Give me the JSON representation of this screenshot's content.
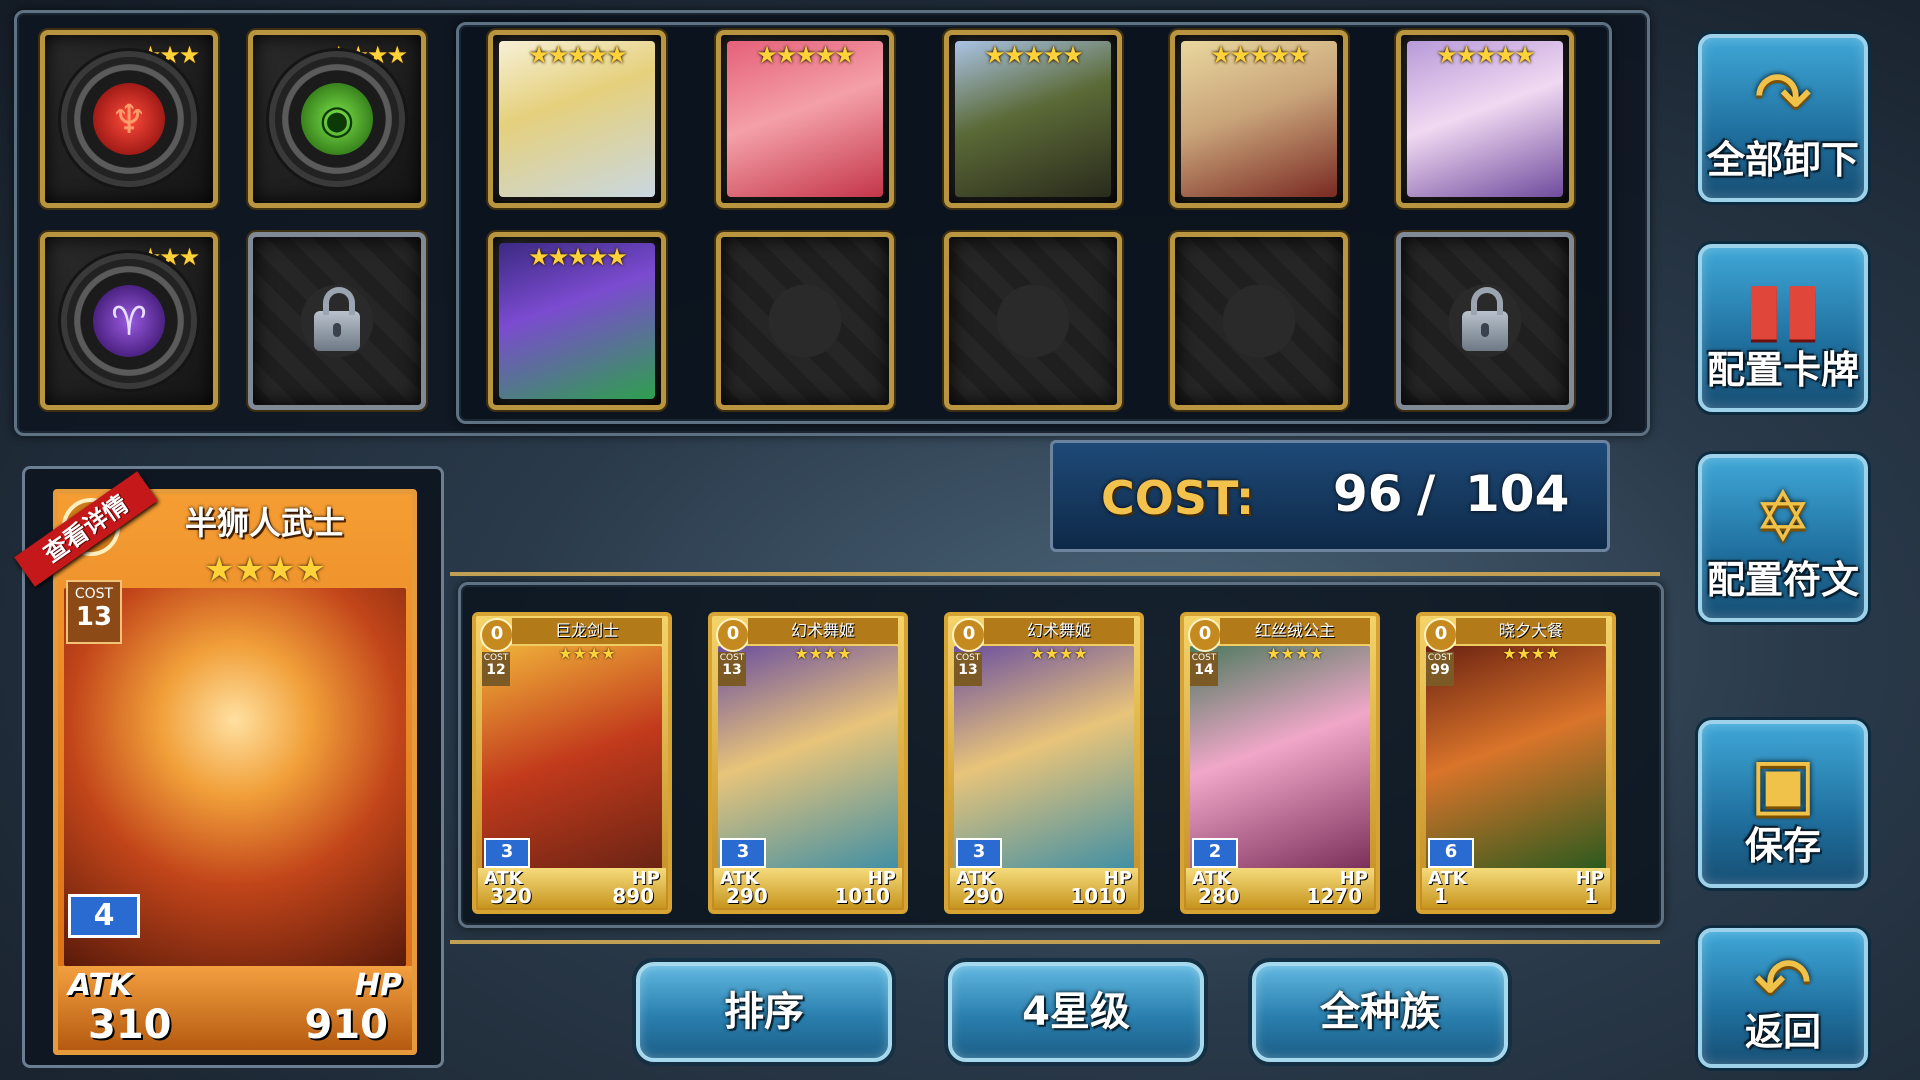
{
  "runes": [
    {
      "stars": "★★★",
      "symbol": "♆",
      "gem_color": "#c0161a",
      "sym_color": "#ff5a3a",
      "icon": "fire-rune-icon"
    },
    {
      "stars": "★★★★",
      "symbol": "◉",
      "gem_color": "#3aa01a",
      "sym_color": "#0c3a06",
      "icon": "eye-rune-icon"
    },
    {
      "stars": "★★★",
      "symbol": "♈",
      "gem_color": "#5a1a9c",
      "sym_color": "#e6ddff",
      "icon": "dark-rune-icon"
    }
  ],
  "deck_slots": [
    {
      "stars": "★★★★★",
      "art": "linear-gradient(160deg,#f7f0d6,#e5d07c 40%,#c9d7e0)"
    },
    {
      "stars": "★★★★★",
      "art": "linear-gradient(160deg,#e5607a,#f4a0a8 45%,#c4364a)"
    },
    {
      "stars": "★★★★★",
      "art": "linear-gradient(160deg,#aac3e6,#5b6a37 45%,#2a2b1c)"
    },
    {
      "stars": "★★★★★",
      "art": "linear-gradient(160deg,#e9d79e,#c9a47a 45%,#7a2a22)"
    },
    {
      "stars": "★★★★★",
      "art": "linear-gradient(160deg,#b79ad8,#f1d9f2 45%,#6f4c9e)"
    },
    {
      "stars": "★★★★★",
      "art": "linear-gradient(160deg,#3b2a82,#7b4bd0 40%,#2ea04d)"
    }
  ],
  "cost": {
    "label": "COST:",
    "current": "96",
    "slash": "/",
    "max": "104"
  },
  "featured": {
    "ribbon": "查看详情",
    "badge_value": "0",
    "name": "半狮人武士",
    "stars": "★★★★",
    "cost_label": "COST",
    "cost_value": "13",
    "level": "4",
    "atk_label": "ATK",
    "hp_label": "HP",
    "atk": "310",
    "hp": "910"
  },
  "cards": [
    {
      "badge": "0",
      "name": "巨龙剑士",
      "cost_label": "COST",
      "cost": "12",
      "stars": "★★★★",
      "level": "3",
      "atk_label": "ATK",
      "hp_label": "HP",
      "atk": "320",
      "hp": "890",
      "art": "linear-gradient(160deg,#f1b43a,#c23a1c 50%,#6a2414)"
    },
    {
      "badge": "0",
      "name": "幻术舞姬",
      "cost_label": "COST",
      "cost": "13",
      "stars": "★★★★",
      "level": "3",
      "atk_label": "ATK",
      "hp_label": "HP",
      "atk": "290",
      "hp": "1010",
      "art": "linear-gradient(160deg,#6a4fa0,#e8c47a 45%,#3f8fa5)"
    },
    {
      "badge": "0",
      "name": "幻术舞姬",
      "cost_label": "COST",
      "cost": "13",
      "stars": "★★★★",
      "level": "3",
      "atk_label": "ATK",
      "hp_label": "HP",
      "atk": "290",
      "hp": "1010",
      "art": "linear-gradient(160deg,#6a4fa0,#e8c47a 45%,#3f8fa5)"
    },
    {
      "badge": "0",
      "name": "红丝绒公主",
      "cost_label": "COST",
      "cost": "14",
      "stars": "★★★★",
      "level": "2",
      "atk_label": "ATK",
      "hp_label": "HP",
      "atk": "280",
      "hp": "1270",
      "art": "linear-gradient(160deg,#4c7a5e,#f0a7c8 45%,#7a2f5a)"
    },
    {
      "badge": "0",
      "name": "晓夕大餐",
      "cost_label": "COST",
      "cost": "99",
      "stars": "★★★★",
      "level": "6",
      "atk_label": "ATK",
      "hp_label": "HP",
      "atk": "1",
      "hp": "1",
      "art": "linear-gradient(160deg,#6b2212,#d9742a 45%,#2a5a1e)"
    }
  ],
  "side_buttons": {
    "unequip_all": "全部卸下",
    "config_cards": "配置卡牌",
    "config_runes": "配置符文",
    "save": "保存",
    "back": "返回"
  },
  "bottom_buttons": {
    "sort": "排序",
    "star_filter": "4星级",
    "race_filter": "全种族"
  }
}
